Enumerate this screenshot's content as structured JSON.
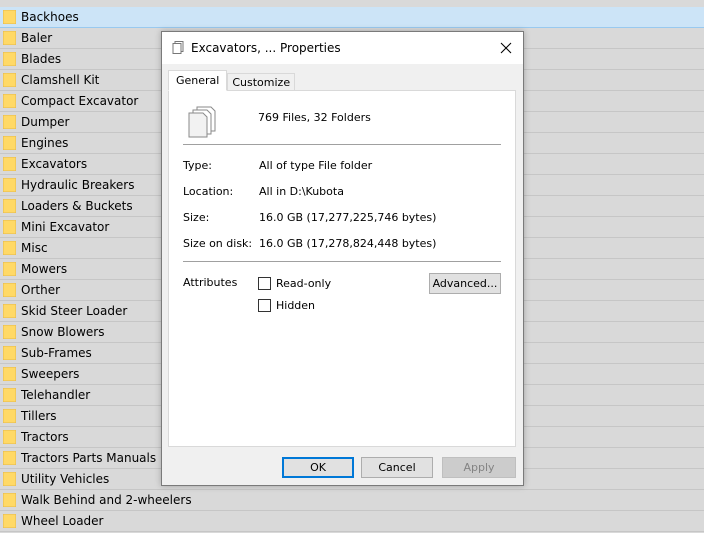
{
  "folders": [
    {
      "name": "Backhoes",
      "selected": true
    },
    {
      "name": "Baler"
    },
    {
      "name": "Blades"
    },
    {
      "name": "Clamshell Kit"
    },
    {
      "name": "Compact Excavator"
    },
    {
      "name": "Dumper"
    },
    {
      "name": "Engines"
    },
    {
      "name": "Excavators"
    },
    {
      "name": "Hydraulic Breakers"
    },
    {
      "name": "Loaders & Buckets"
    },
    {
      "name": "Mini Excavator"
    },
    {
      "name": "Misc"
    },
    {
      "name": "Mowers"
    },
    {
      "name": "Orther"
    },
    {
      "name": "Skid Steer Loader"
    },
    {
      "name": "Snow Blowers"
    },
    {
      "name": "Sub-Frames"
    },
    {
      "name": "Sweepers"
    },
    {
      "name": "Telehandler"
    },
    {
      "name": "Tillers"
    },
    {
      "name": "Tractors"
    },
    {
      "name": "Tractors Parts Manuals"
    },
    {
      "name": "Utility Vehicles"
    },
    {
      "name": "Walk Behind and 2-wheelers"
    },
    {
      "name": "Wheel Loader"
    }
  ],
  "dialog": {
    "title": "Excavators, ... Properties",
    "tabs": [
      {
        "label": "General",
        "active": true
      },
      {
        "label": "Customize",
        "active": false
      }
    ],
    "summary": "769 Files, 32 Folders",
    "properties": [
      {
        "label": "Type:",
        "value": "All of type File folder"
      },
      {
        "label": "Location:",
        "value": "All in D:\\Kubota"
      },
      {
        "label": "Size:",
        "value": "16.0 GB (17,277,225,746 bytes)"
      },
      {
        "label": "Size on disk:",
        "value": "16.0 GB (17,278,824,448 bytes)"
      }
    ],
    "attributes_label": "Attributes",
    "attributes": [
      {
        "label": "Read-only",
        "checked": false
      },
      {
        "label": "Hidden",
        "checked": false
      }
    ],
    "advanced_label": "Advanced...",
    "ok_label": "OK",
    "cancel_label": "Cancel",
    "apply_label": "Apply"
  },
  "colors": {
    "selected_row": "#cce4f7",
    "folder_yellow": "#ffd966",
    "accent": "#0078d7"
  }
}
